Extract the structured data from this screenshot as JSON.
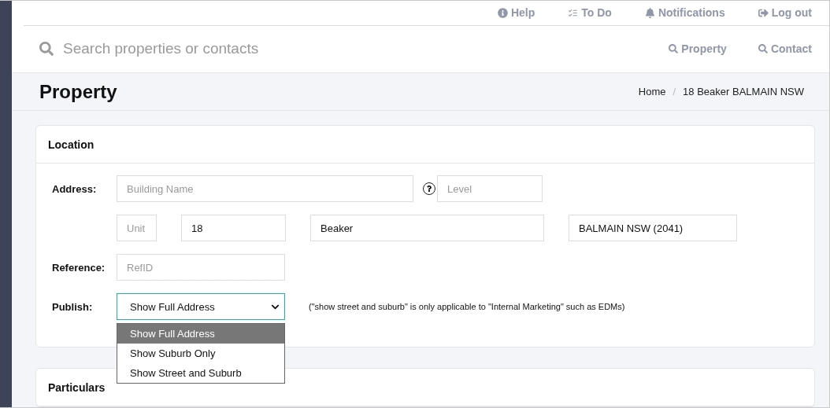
{
  "top_nav": [
    {
      "label": "Help"
    },
    {
      "label": "To Do"
    },
    {
      "label": "Notifications"
    },
    {
      "label": "Log out"
    }
  ],
  "search": {
    "placeholder": "Search properties or contacts",
    "scopes": [
      {
        "label": "Property"
      },
      {
        "label": "Contact"
      }
    ]
  },
  "page_header": {
    "title": "Property",
    "breadcrumb": [
      "Home",
      "18 Beaker BALMAIN NSW"
    ],
    "separator": "/"
  },
  "location_card": {
    "title": "Location",
    "address_label": "Address:",
    "address_row_1": [
      {
        "placeholder": "Building Name"
      },
      {
        "placeholder": "Level"
      }
    ],
    "address_row_2": [
      {
        "placeholder": "Unit"
      },
      {
        "value": "18"
      },
      {
        "value": "Beaker"
      },
      {
        "value": "BALMAIN NSW (2041)"
      }
    ],
    "reference_label": "Reference:",
    "reference": {
      "placeholder": "RefID"
    },
    "publish_label": "Publish:",
    "publish": {
      "value": "Show Full Address",
      "expanded": true,
      "note": "(\"show street and suburb\" is only applicable to \"Internal Marketing\" such as EDMs)",
      "options": [
        {
          "label": "Show Full Address",
          "selected": true
        },
        {
          "label": "Show Suburb Only",
          "selected": false
        },
        {
          "label": "Show Street and Suburb",
          "selected": false
        }
      ]
    }
  },
  "particulars_card": {
    "title": "Particulars"
  }
}
